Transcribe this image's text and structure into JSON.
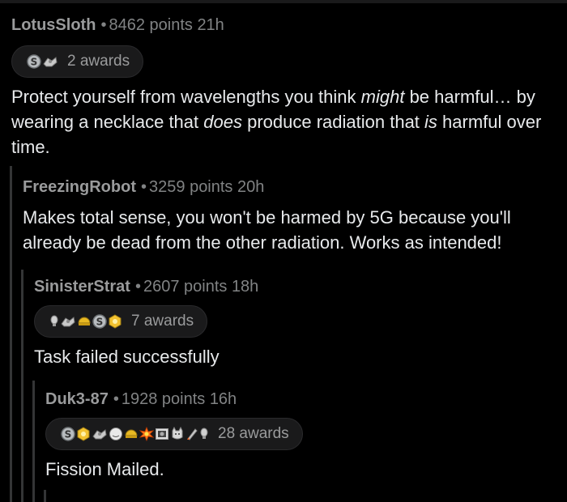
{
  "comments": [
    {
      "user": "LotusSloth",
      "points": "8462 points",
      "age": "21h",
      "awards_label": "2 awards",
      "awards": [
        "silver-award-icon",
        "helpful-hand-award-icon"
      ],
      "body": {
        "p1": "Protect yourself from wavelengths you think ",
        "e1": "might",
        "p2": " be harmful… by wearing a necklace that ",
        "e2": "does",
        "p3": " produce radiation that ",
        "e3": "is",
        "p4": " harmful over time."
      }
    },
    {
      "user": "FreezingRobot",
      "points": "3259 points",
      "age": "20h",
      "body": "Makes total sense, you won't be harmed by 5G because you'll already be dead from the other radiation. Works as intended!"
    },
    {
      "user": "SinisterStrat",
      "points": "2607 points",
      "age": "18h",
      "awards_label": "7 awards",
      "awards": [
        "bulb-award-icon",
        "helpful-hand-award-icon",
        "helmet-award-icon",
        "silver-award-icon",
        "gold-badge-award-icon"
      ],
      "body": "Task failed successfully"
    },
    {
      "user": "Duk3-87",
      "points": "1928 points",
      "age": "16h",
      "awards_label": "28 awards",
      "awards": [
        "silver-award-icon",
        "gold-badge-award-icon",
        "helpful-hand-award-icon",
        "face-award-icon",
        "helmet-award-icon",
        "explosion-award-icon",
        "framed-picture-award-icon",
        "cat-award-icon",
        "rocket-award-icon",
        "bulb-award-icon"
      ],
      "body": "Fission Mailed."
    }
  ],
  "meta_separator": "•",
  "colors": {
    "background": "#000000",
    "thread_line": "#343536",
    "meta_text": "#818384",
    "body_text": "#e8eaec"
  }
}
